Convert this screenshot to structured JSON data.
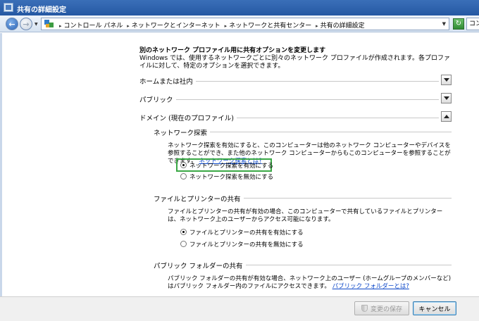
{
  "window": {
    "title": "共有の詳細設定"
  },
  "nav": {
    "breadcrumbs": [
      "コントロール パネル",
      "ネットワークとインターネット",
      "ネットワークと共有センター",
      "共有の詳細設定"
    ],
    "search_text": "コン"
  },
  "page": {
    "heading": "別のネットワーク プロファイル用に共有オプションを変更します",
    "description": "Windows では、使用するネットワークごとに別々のネットワーク プロファイルが作成されます。各プロファイルに対して、特定のオプションを選択できます。"
  },
  "profiles": [
    {
      "label": "ホームまたは社内",
      "expanded": false
    },
    {
      "label": "パブリック",
      "expanded": false
    },
    {
      "label": "ドメイン (現在のプロファイル)",
      "expanded": true
    }
  ],
  "sections": {
    "network_discovery": {
      "title": "ネットワーク探索",
      "description": "ネットワーク探索を有効にすると、このコンピューターは他のネットワーク コンピューターやデバイスを参照することができ、また他のネットワーク コンピューターからもこのコンピューターを参照することができます。",
      "link": "ネットワーク探索とは?",
      "options": [
        "ネットワーク探索を有効にする",
        "ネットワーク探索を無効にする"
      ],
      "selected": 0
    },
    "file_printer": {
      "title": "ファイルとプリンターの共有",
      "description": "ファイルとプリンターの共有が有効の場合、このコンピューターで共有しているファイルとプリンターは、ネットワーク上のユーザーからアクセス可能になります。",
      "options": [
        "ファイルとプリンターの共有を有効にする",
        "ファイルとプリンターの共有を無効にする"
      ],
      "selected": 0
    },
    "public_folder": {
      "title": "パブリック フォルダーの共有",
      "description": "パブリック フォルダーの共有が有効な場合、ネットワーク上のユーザー (ホームグループのメンバーなど) はパブリック フォルダー内のファイルにアクセスできます。",
      "link": "パブリック フォルダーとは?"
    }
  },
  "buttons": {
    "save": "変更の保存",
    "cancel": "キャンセル"
  },
  "colors": {
    "highlight": "#3aa845",
    "link": "#0a46c8"
  }
}
